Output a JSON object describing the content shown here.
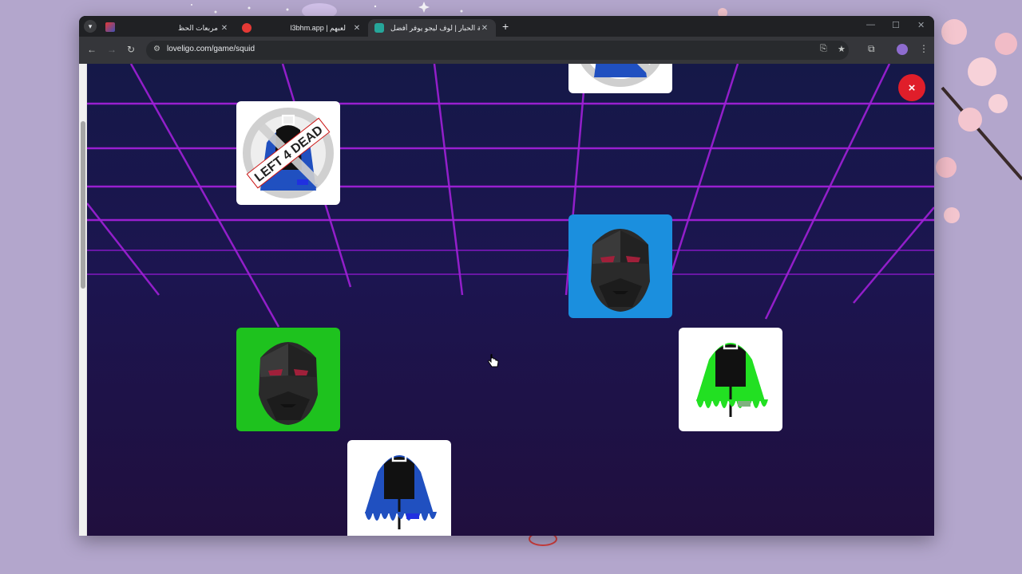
{
  "browser": {
    "tabs": [
      {
        "title": "مربعات الحظ",
        "favicon_color": "#e53935",
        "active": false
      },
      {
        "title": "l3bhm.app | لعبهم",
        "favicon_color": "#e53935",
        "active": false
      },
      {
        "title": "لعبة الحبار | لوف ليجو يوفر أفضل",
        "favicon_color": "#26a69a",
        "active": true
      }
    ],
    "url": "loveligo.com/game/squid"
  },
  "game": {
    "close_label": "×",
    "cards": [
      {
        "type": "hood",
        "label": "LEFT 4 DEAD",
        "bg": "#ffffff",
        "hood_color": "#2050c0",
        "banned": true,
        "partial": true
      },
      {
        "type": "hood",
        "label": "LEFT 4 DEAD",
        "bg": "#ffffff",
        "hood_color": "#2050c0",
        "banned": true,
        "partial": false
      },
      {
        "type": "mask",
        "bg": "#1b8fde"
      },
      {
        "type": "mask",
        "bg": "#1ec21e"
      },
      {
        "type": "hood",
        "bg": "#ffffff",
        "hood_color": "#22e022",
        "banned": false
      },
      {
        "type": "hood",
        "bg": "#ffffff",
        "hood_color": "#2050c0",
        "banned": false
      }
    ]
  },
  "colors": {
    "grid_line": "#a020d8",
    "close_button": "#e01e2a"
  }
}
